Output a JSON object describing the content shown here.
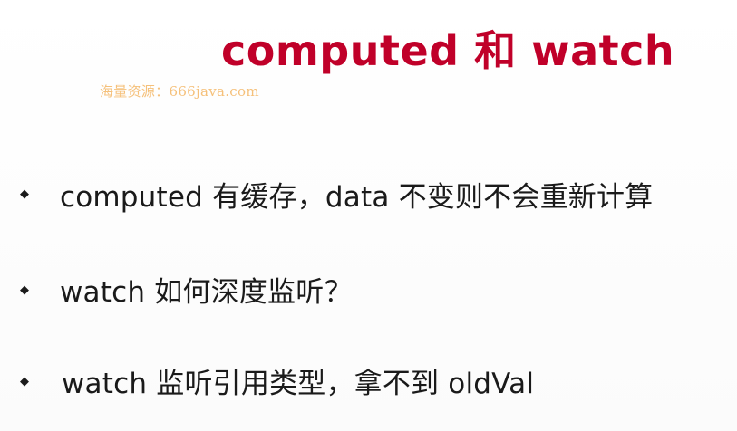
{
  "slide": {
    "title": "computed 和 watch",
    "watermark": "海量资源：666java.com",
    "bullets": [
      {
        "icon": "diamond-bullet",
        "text": "computed 有缓存，data 不变则不会重新计算"
      },
      {
        "icon": "diamond-bullet",
        "text": "watch 如何深度监听？"
      },
      {
        "icon": "diamond-bullet",
        "text": "watch 监听引用类型，拿不到 oldVal"
      }
    ]
  },
  "colors": {
    "title": "#c00029",
    "watermark": "#f5c07a",
    "text": "#1a1a1a",
    "background": "#ffffff"
  }
}
